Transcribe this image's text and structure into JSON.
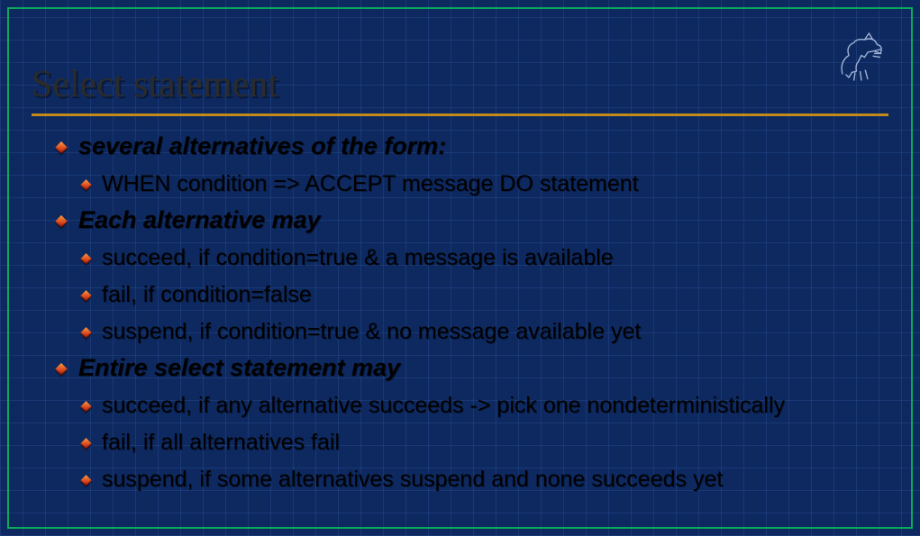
{
  "title": "Select statement",
  "bullets": {
    "b1": "several alternatives of the form:",
    "b1_1": "WHEN condition => ACCEPT message DO statement",
    "b2": "Each alternative may",
    "b2_1": "succeed, if condition=true & a message is available",
    "b2_2": "fail, if condition=false",
    "b2_3": "suspend, if condition=true & no message available yet",
    "b3": "Entire select statement may",
    "b3_1": "succeed, if any alternative succeeds -> pick one nondeterministically",
    "b3_2": "fail, if all alternatives fail",
    "b3_3": "suspend, if some alternatives suspend and none succeeds yet"
  }
}
